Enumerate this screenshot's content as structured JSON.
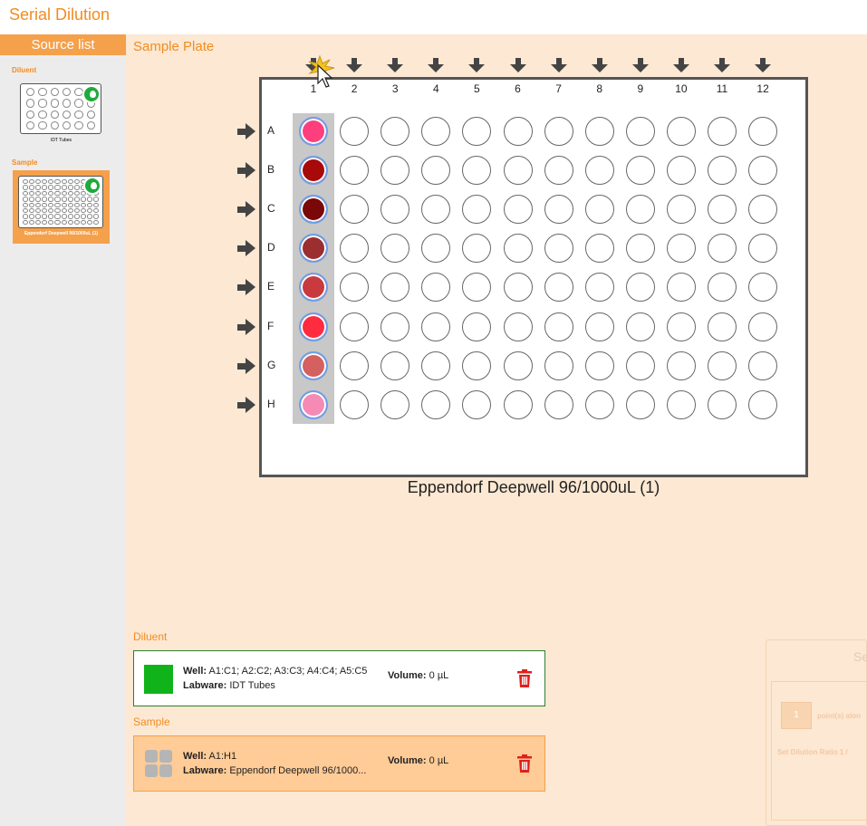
{
  "app": {
    "title": "Serial Dilution"
  },
  "sidebar": {
    "header": "Source list",
    "sources": [
      {
        "group": "Diluent",
        "caption": "IDT Tubes"
      },
      {
        "group": "Sample",
        "caption": "Eppendorf Deepwell 96/1000uL (1)"
      }
    ]
  },
  "plate": {
    "section_title": "Sample Plate",
    "name": "Eppendorf Deepwell 96/1000uL (1)",
    "columns": [
      "1",
      "2",
      "3",
      "4",
      "5",
      "6",
      "7",
      "8",
      "9",
      "10",
      "11",
      "12"
    ],
    "rows": [
      "A",
      "B",
      "C",
      "D",
      "E",
      "F",
      "G",
      "H"
    ],
    "filled_wells": [
      {
        "well": "A1",
        "color": "#ff3f7d"
      },
      {
        "well": "B1",
        "color": "#a80a0a"
      },
      {
        "well": "C1",
        "color": "#7a0808"
      },
      {
        "well": "D1",
        "color": "#9b2e2e"
      },
      {
        "well": "E1",
        "color": "#c93a3e"
      },
      {
        "well": "F1",
        "color": "#ff2c3f"
      },
      {
        "well": "G1",
        "color": "#d46060"
      },
      {
        "well": "H1",
        "color": "#f58bb4"
      }
    ]
  },
  "assignments": {
    "diluent": {
      "label": "Diluent",
      "well_label": "Well:",
      "well": "A1:C1; A2:C2; A3:C3; A4:C4; A5:C5",
      "labware_label": "Labware:",
      "labware": "IDT Tubes",
      "volume_label": "Volume:",
      "volume": "0 µL",
      "color": "#11b31a"
    },
    "sample": {
      "label": "Sample",
      "well_label": "Well:",
      "well": "A1:H1",
      "labware_label": "Labware:",
      "labware": "Eppendorf Deepwell 96/1000...",
      "volume_label": "Volume:",
      "volume": "0 µL"
    }
  },
  "ghost_panel": {
    "title": "Se",
    "points_value": "1",
    "points_label": "point(s) alon",
    "ratio_label": "Set Dilution Ratio  1 /"
  },
  "colors": {
    "accent": "#f28c1e",
    "panel": "#fce8d3",
    "delete": "#e0201b"
  }
}
